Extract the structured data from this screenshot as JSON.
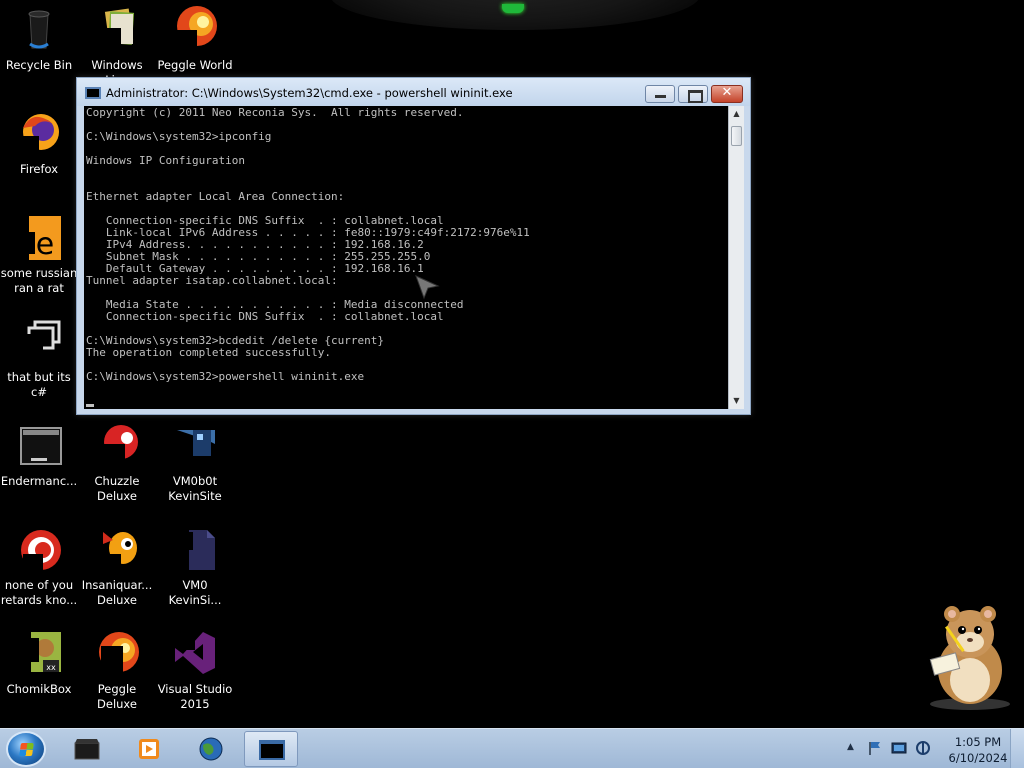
{
  "desktop": {
    "icons": [
      {
        "label": "Recycle Bin",
        "icon": "recycle-bin-icon"
      },
      {
        "label": "Windows Live",
        "icon": "windows-live-icon"
      },
      {
        "label": "Peggle World",
        "icon": "peggle-icon"
      },
      {
        "label": "Firefox",
        "icon": "firefox-icon"
      },
      {
        "label": "some russian ran a rat",
        "icon": "orange-app-icon"
      },
      {
        "label": "that but its c#",
        "icon": "shortcut-icon"
      },
      {
        "label": "Endermanc...",
        "icon": "terminal-icon"
      },
      {
        "label": "Chuzzle Deluxe",
        "icon": "chuzzle-icon"
      },
      {
        "label": "VM0b0t KevinSite",
        "icon": "vm0b0t-icon"
      },
      {
        "label": "none of you retards kno...",
        "icon": "red-swirl-icon"
      },
      {
        "label": "Insaniquar... Deluxe",
        "icon": "insaniquarium-icon"
      },
      {
        "label": "VM0 KevinSi...",
        "icon": "vm0-icon"
      },
      {
        "label": "ChomikBox",
        "icon": "chomikbox-icon"
      },
      {
        "label": "Peggle Deluxe",
        "icon": "peggle-deluxe-icon"
      },
      {
        "label": "Visual Studio 2015",
        "icon": "visual-studio-icon"
      }
    ]
  },
  "window": {
    "title": "Administrator: C:\\Windows\\System32\\cmd.exe - powershell  wininit.exe",
    "close_label": "✕",
    "console_text": "Copyright (c) 2011 Neo Reconia Sys.  All rights reserved.\n\nC:\\Windows\\system32>ipconfig\n\nWindows IP Configuration\n\n\nEthernet adapter Local Area Connection:\n\n   Connection-specific DNS Suffix  . : collabnet.local\n   Link-local IPv6 Address . . . . . : fe80::1979:c49f:2172:976e%11\n   IPv4 Address. . . . . . . . . . . : 192.168.16.2\n   Subnet Mask . . . . . . . . . . . : 255.255.255.0\n   Default Gateway . . . . . . . . . : 192.168.16.1\nTunnel adapter isatap.collabnet.local:\n\n   Media State . . . . . . . . . . . : Media disconnected\n   Connection-specific DNS Suffix  . : collabnet.local\n\nC:\\Windows\\system32>bcdedit /delete {current}\nThe operation completed successfully.\n\nC:\\Windows\\system32>powershell wininit.exe",
    "scroll_up": "▲",
    "scroll_down": "▼"
  },
  "taskbar": {
    "pinned": [
      {
        "icon": "dark-folder-icon"
      },
      {
        "icon": "media-player-icon"
      },
      {
        "icon": "globe-icon"
      },
      {
        "icon": "cmd-icon"
      }
    ],
    "tray_arrow": "▲",
    "time": "1:05 PM",
    "date": "6/10/2024"
  },
  "colors": {
    "console_text": "#c0c0c0",
    "desktop_bg": "#000000",
    "taskbar": "#a9c1dd"
  }
}
